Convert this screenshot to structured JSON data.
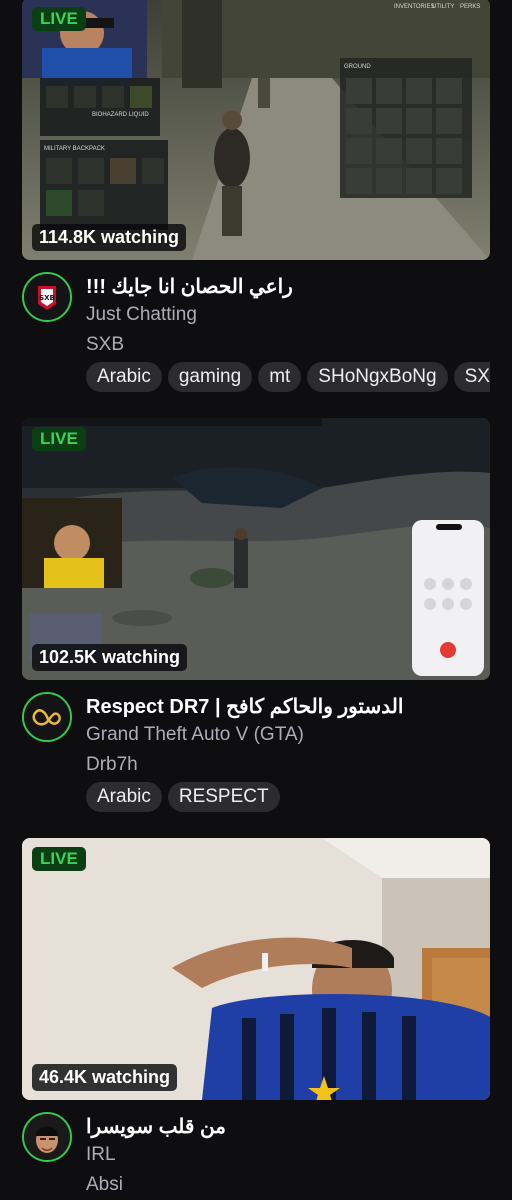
{
  "colors": {
    "background": "#0e0e10",
    "live_green": "#38d35a",
    "avatar_ring": "#35c94d",
    "tag_bg": "#2b2b30",
    "muted_text": "#adadb8"
  },
  "streams": [
    {
      "live_label": "LIVE",
      "viewers": "114.8K watching",
      "title": "راعي الحصان انا جايك !!!",
      "category": "Just Chatting",
      "streamer": "SXB",
      "avatar_text": "SXB",
      "tags": [
        "Arabic",
        "gaming",
        "mt",
        "SHoNgxBoNg",
        "SXB"
      ],
      "overlay": {
        "inventory_header": "MILITARY BACKPACK",
        "biohazard": "BIOHAZARD LIQUID",
        "ground_label": "GROUND",
        "menu_items": [
          "INVENTORIES",
          "UTILITY",
          "PERKS"
        ]
      }
    },
    {
      "live_label": "LIVE",
      "viewers": "102.5K watching",
      "title": "الدستور والحاكم كافح | Respect DR7",
      "category": "Grand Theft Auto V (GTA)",
      "streamer": "Drb7h",
      "tags": [
        "Arabic",
        "RESPECT"
      ]
    },
    {
      "live_label": "LIVE",
      "viewers": "46.4K watching",
      "title": "من قلب سويسرا",
      "category": "IRL",
      "streamer": "Absi",
      "tags": []
    }
  ]
}
